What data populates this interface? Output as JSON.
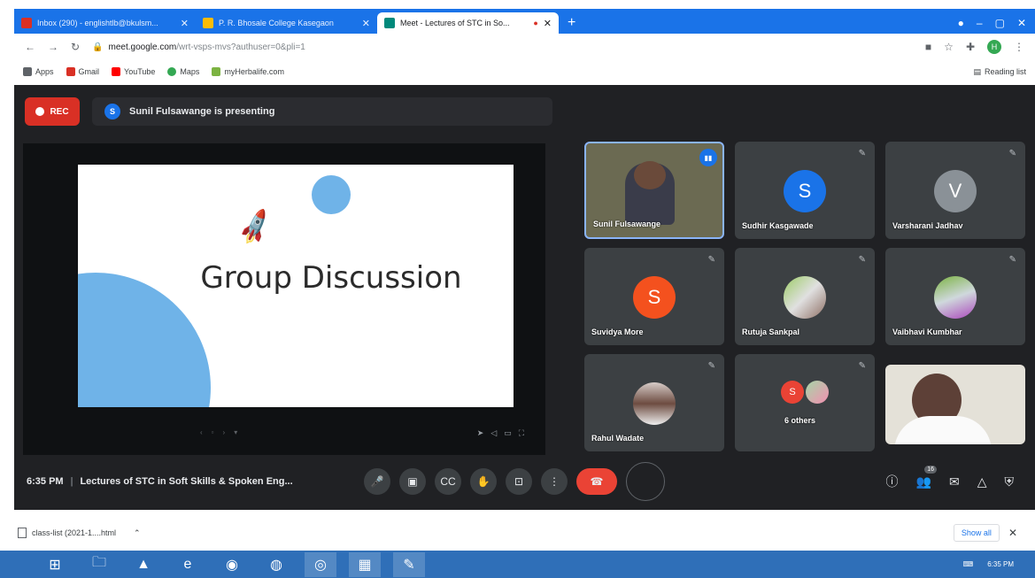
{
  "browser": {
    "tabs": [
      {
        "title": "Inbox (290) - englishtlb@bkulsm...",
        "favicon_color": "#d93025"
      },
      {
        "title": "P. R. Bhosale College Kasegaon",
        "favicon_color": "#fbbc04"
      },
      {
        "title": "Meet - Lectures of STC in So...",
        "favicon_color": "#00897b"
      }
    ],
    "new_tab_label": "+",
    "url_host": "meet.google.com",
    "url_rest": "/wrt-vsps-mvs?authuser=0&pli=1",
    "profile_letter": "H",
    "bookmarks": [
      {
        "label": "Apps",
        "color": "#5f6368"
      },
      {
        "label": "Gmail",
        "color": "#d93025"
      },
      {
        "label": "YouTube",
        "color": "#ff0000"
      },
      {
        "label": "Maps",
        "color": "#34a853"
      },
      {
        "label": "myHerbalife.com",
        "color": "#7cb342"
      }
    ],
    "reading_list": "Reading list"
  },
  "meet": {
    "rec_label": "REC",
    "presenter_initial": "S",
    "presenting_text": "Sunil Fulsawange is presenting",
    "slide": {
      "title": "Group Discussion"
    },
    "participants": [
      {
        "name": "Sunil Fulsawange",
        "type": "video"
      },
      {
        "name": "Sudhir Kasgawade",
        "initial": "S",
        "color": "#1a73e8"
      },
      {
        "name": "Varsharani Jadhav",
        "initial": "V",
        "color": "#8a9197"
      },
      {
        "name": "Suvidya More",
        "initial": "S",
        "color": "#f4511e"
      },
      {
        "name": "Rutuja Sankpal",
        "type": "photo"
      },
      {
        "name": "Vaibhavi Kumbhar",
        "type": "photo"
      },
      {
        "name": "Rahul Wadate",
        "type": "photo"
      },
      {
        "name": "6 others",
        "initial": "S",
        "color": "#ea4335"
      }
    ],
    "time": "6:35 PM",
    "meeting_title": "Lectures of STC in Soft Skills & Spoken Eng...",
    "participant_count": "16"
  },
  "downloads": {
    "file": "class-list (2021-1....html",
    "show_all": "Show all"
  },
  "taskbar": {
    "time": "6:35 PM"
  }
}
